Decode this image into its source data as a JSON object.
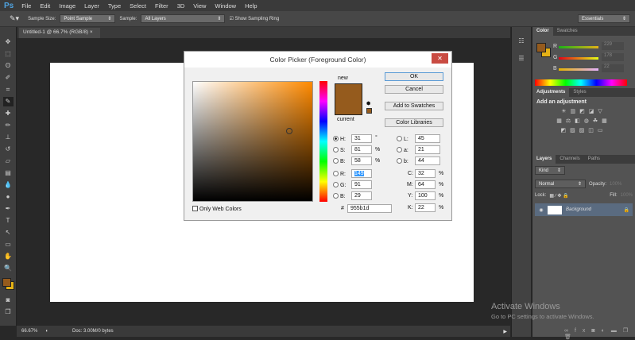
{
  "app": {
    "logo": "Ps",
    "menu": [
      "File",
      "Edit",
      "Image",
      "Layer",
      "Type",
      "Select",
      "Filter",
      "3D",
      "View",
      "Window",
      "Help"
    ]
  },
  "options": {
    "sample_size_label": "Sample Size:",
    "sample_size": "Point Sample",
    "sample_label": "Sample:",
    "sample": "All Layers",
    "show_ring": "Show Sampling Ring",
    "workspace": "Essentials"
  },
  "doc_tab": {
    "title": "Untitled-1 @ 66.7% (RGB/8)",
    "close": "×"
  },
  "status": {
    "zoom": "66.67%",
    "doc": "Doc: 3.00M/0 bytes"
  },
  "dialog": {
    "title": "Color Picker (Foreground Color)",
    "new": "new",
    "current": "current",
    "ok": "OK",
    "cancel": "Cancel",
    "add": "Add to Swatches",
    "libraries": "Color Libraries",
    "only_web": "Only Web Colors",
    "H": "31",
    "S": "81",
    "Bv": "58",
    "R": "149",
    "G": "91",
    "B": "29",
    "L": "45",
    "a": "21",
    "b": "44",
    "C": "32",
    "M": "64",
    "Y": "100",
    "K": "22",
    "hex": "955b1d",
    "deg": "°",
    "pct": "%",
    "hash": "#",
    "new_color": "#955b1d",
    "current_color": "#955b1d"
  },
  "color_panel": {
    "tabs": [
      "Color",
      "Swatches"
    ],
    "R": "229",
    "G": "178",
    "B": "22"
  },
  "adjust_panel": {
    "tabs": [
      "Adjustments",
      "Styles"
    ],
    "heading": "Add an adjustment"
  },
  "layers_panel": {
    "tabs": [
      "Layers",
      "Channels",
      "Paths"
    ],
    "kind": "Kind",
    "blend": "Normal",
    "opacity_label": "Opacity:",
    "opacity": "100%",
    "lock": "Lock:",
    "fill_label": "Fill:",
    "fill": "100%",
    "layer": "Background"
  },
  "watermark": {
    "title": "Activate Windows",
    "sub": "Go to PC settings to activate Windows."
  }
}
